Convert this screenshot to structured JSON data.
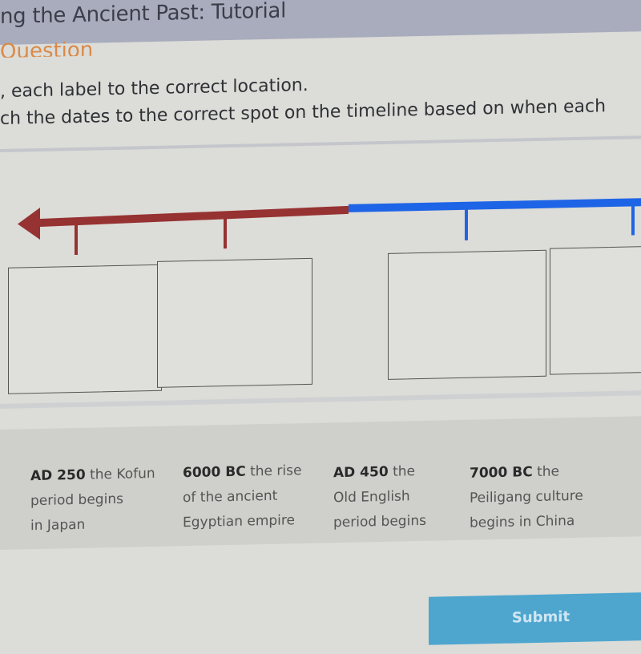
{
  "header": {
    "title": "ng the Ancient Past: Tutorial"
  },
  "question": {
    "section_label": "Question",
    "instruction": ", each label to the correct location.",
    "prompt": "ch the dates to the correct spot on the timeline based on when each"
  },
  "timeline": {
    "bc_color": "#963232",
    "ad_color": "#1e64e6",
    "bc_arrow": "arrow-left",
    "drop_targets": [
      "",
      "",
      "",
      ""
    ]
  },
  "labels": [
    {
      "bold": "AD 250",
      "line1": " the Kofun",
      "line2": "period begins",
      "line3": "in Japan"
    },
    {
      "bold": "6000 BC",
      "line1": " the rise",
      "line2": "of the ancient",
      "line3": "Egyptian empire"
    },
    {
      "bold": "AD 450",
      "line1": " the",
      "line2": "Old English",
      "line3": "period begins"
    },
    {
      "bold": "7000 BC",
      "line1": " the",
      "line2": "Peiligang culture",
      "line3": "begins in China"
    }
  ],
  "submit": {
    "label": "Submit",
    "color": "#4ea6cf"
  }
}
